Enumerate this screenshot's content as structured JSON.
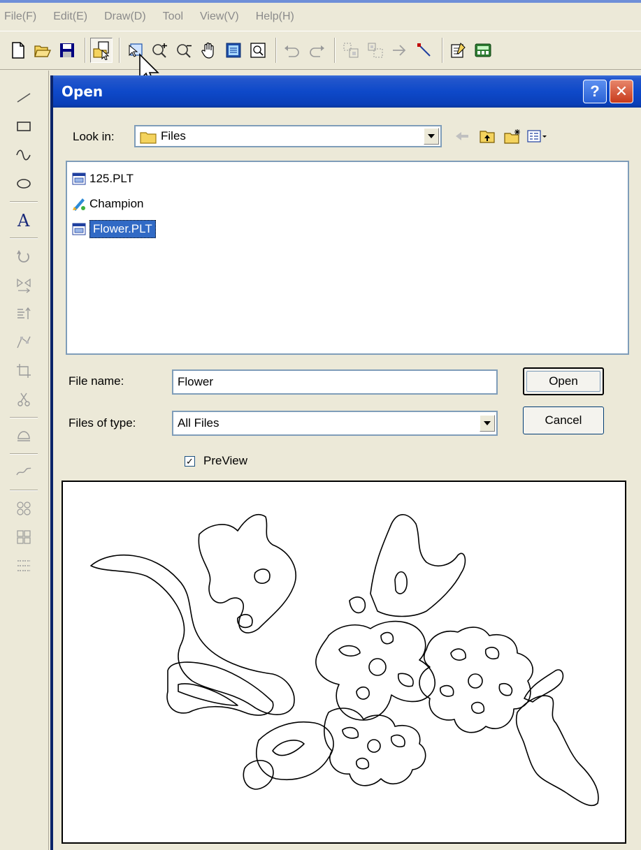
{
  "menu": [
    "File(F)",
    "Edit(E)",
    "Draw(D)",
    "Tool",
    "View(V)",
    "Help(H)"
  ],
  "toolbar": {
    "icons": [
      "new-file-icon",
      "open-folder-icon",
      "save-icon",
      "open-preview-icon",
      "node-edit-icon",
      "zoom-in-icon",
      "zoom-out-icon",
      "pan-hand-icon",
      "fit-page-icon",
      "zoom-fit-icon",
      "undo-icon",
      "redo-icon",
      "group-icon",
      "ungroup-icon",
      "arrow-right-icon",
      "line-tool-icon",
      "properties-icon",
      "calculator-icon"
    ]
  },
  "dialog": {
    "title": "Open",
    "help_label": "?",
    "close_label": "✕",
    "look_in_label": "Look in:",
    "look_in_value": "Files",
    "files": [
      {
        "name": "125.PLT",
        "icon": "plt-file-icon",
        "selected": false
      },
      {
        "name": "Champion",
        "icon": "image-file-icon",
        "selected": false
      },
      {
        "name": "Flower.PLT",
        "icon": "plt-file-icon",
        "selected": true
      }
    ],
    "file_name_label": "File name:",
    "file_name_value": "Flower",
    "files_of_type_label": "Files of type:",
    "files_of_type_value": "All Files",
    "open_button": "Open",
    "cancel_button": "Cancel",
    "preview_label": "PreView",
    "preview_checked": true
  },
  "colors": {
    "title_bar": "#0e49c9",
    "selection": "#316ac5",
    "window_bg": "#ece9d8"
  }
}
